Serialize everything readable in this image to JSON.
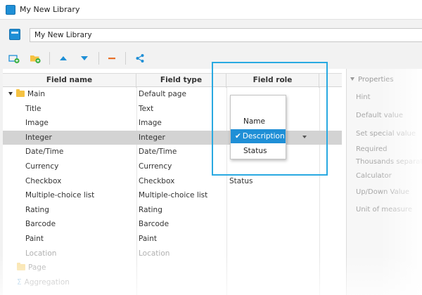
{
  "window": {
    "title": "My New Library"
  },
  "library": {
    "name": "My New Library"
  },
  "table": {
    "headers": {
      "field_name": "Field name",
      "field_type": "Field type",
      "field_role": "Field role"
    },
    "rows": [
      {
        "name": "Main",
        "type": "Default page",
        "role": "",
        "is_group": true,
        "expanded": true
      },
      {
        "name": "Title",
        "type": "Text",
        "role": ""
      },
      {
        "name": "Image",
        "type": "Image",
        "role": ""
      },
      {
        "name": "Integer",
        "type": "Integer",
        "role": "Description",
        "selected": true
      },
      {
        "name": "Date/Time",
        "type": "Date/Time",
        "role": ""
      },
      {
        "name": "Currency",
        "type": "Currency",
        "role": ""
      },
      {
        "name": "Checkbox",
        "type": "Checkbox",
        "role": "Status"
      },
      {
        "name": "Multiple-choice list",
        "type": "Multiple-choice list",
        "role": ""
      },
      {
        "name": "Rating",
        "type": "Rating",
        "role": ""
      },
      {
        "name": "Barcode",
        "type": "Barcode",
        "role": ""
      },
      {
        "name": "Paint",
        "type": "Paint",
        "role": ""
      },
      {
        "name": "Location",
        "type": "Location",
        "role": ""
      }
    ],
    "extra_groups": [
      {
        "name": "Page",
        "icon": "folder-icon"
      },
      {
        "name": "Aggregation",
        "icon": "sigma-icon",
        "symbol": "Σ"
      }
    ]
  },
  "role_dropdown": {
    "options": [
      "Name",
      "Description",
      "Status"
    ],
    "selected": "Description",
    "check_glyph": "✔"
  },
  "properties": {
    "header": "Properties",
    "labels": [
      "Hint",
      "Default value",
      "Set special value",
      "Required",
      "Thousands separator",
      "Calculator",
      "Up/Down Value",
      "Unit of measure"
    ]
  },
  "colors": {
    "accent": "#1f8fd6",
    "highlight": "#29a9e1",
    "selected_row": "#d3d3d3",
    "remove": "#e8702a"
  }
}
